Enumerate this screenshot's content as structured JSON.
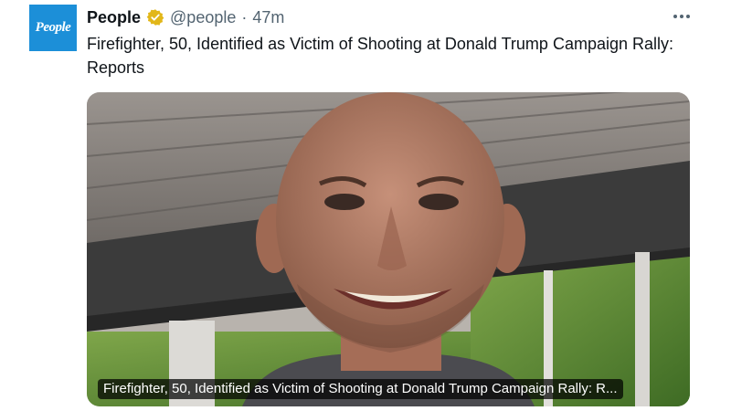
{
  "author": {
    "logo_text": "People",
    "name": "People",
    "handle": "@people",
    "separator": "·",
    "time": "47m"
  },
  "tweet": {
    "text": "Firefighter, 50, Identified as Victim of Shooting at Donald Trump Campaign Rally: Reports"
  },
  "media": {
    "card_title": "Firefighter, 50, Identified as Victim of Shooting at Donald Trump Campaign Rally: R..."
  },
  "icons": {
    "verified": "verified-badge-icon",
    "more": "more-options-icon"
  },
  "colors": {
    "brand": "#1c8fd8",
    "verified_gold": "#e2b719",
    "text": "#0f1419",
    "secondary": "#536471"
  }
}
